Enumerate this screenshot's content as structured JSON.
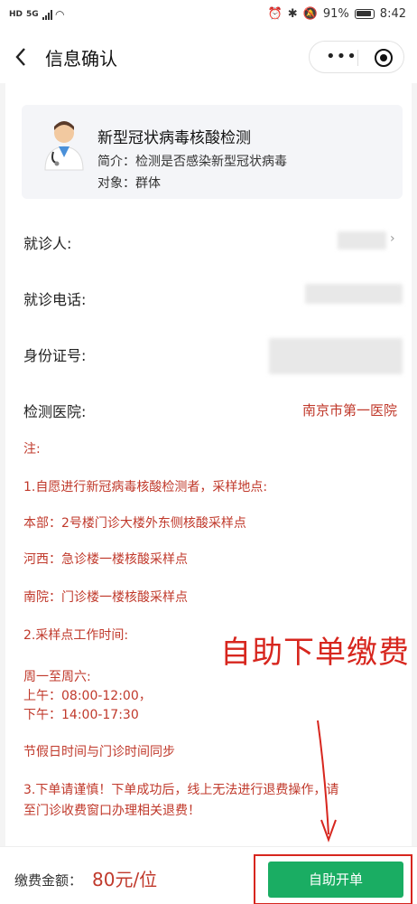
{
  "status_bar": {
    "network_hd": "HD",
    "network_5g": "5G",
    "battery_pct": "91%",
    "time": "8:42"
  },
  "nav": {
    "title": "信息确认",
    "back_icon": "chevron-left-icon",
    "more_icon": "more-dots-icon",
    "close_icon": "target-circle-icon"
  },
  "test": {
    "name": "新型冠状病毒核酸检测",
    "description": "简介：检测是否感染新型冠状病毒",
    "target": "对象：群体",
    "icon": "doctor-icon"
  },
  "form": {
    "patient_label": "就诊人:",
    "phone_label": "就诊电话:",
    "id_label": "身份证号:",
    "hospital_label": "检测医院:",
    "hospital_value": "南京市第一医院"
  },
  "notes": [
    "注:",
    "1.自愿进行新冠病毒核酸检测者，采样地点:",
    "本部：2号楼门诊大楼外东侧核酸采样点",
    "河西：急诊楼一楼核酸采样点",
    "南院：门诊楼一楼核酸采样点",
    "2.采样点工作时间:",
    "周一至周六:",
    "上午：08:00-12:00，",
    "下午：14:00-17:30",
    "节假日时间与门诊时间同步",
    "3.下单请谨慎！下单成功后，线上无法进行退费操作，请",
    "至门诊收费窗口办理相关退费！"
  ],
  "annotation": {
    "text": "自助下单缴费",
    "color": "#d7261e"
  },
  "footer": {
    "fee_label": "缴费金额：",
    "fee_value": "80元/位",
    "submit_label": "自助开单",
    "accent": "#1aad63"
  }
}
